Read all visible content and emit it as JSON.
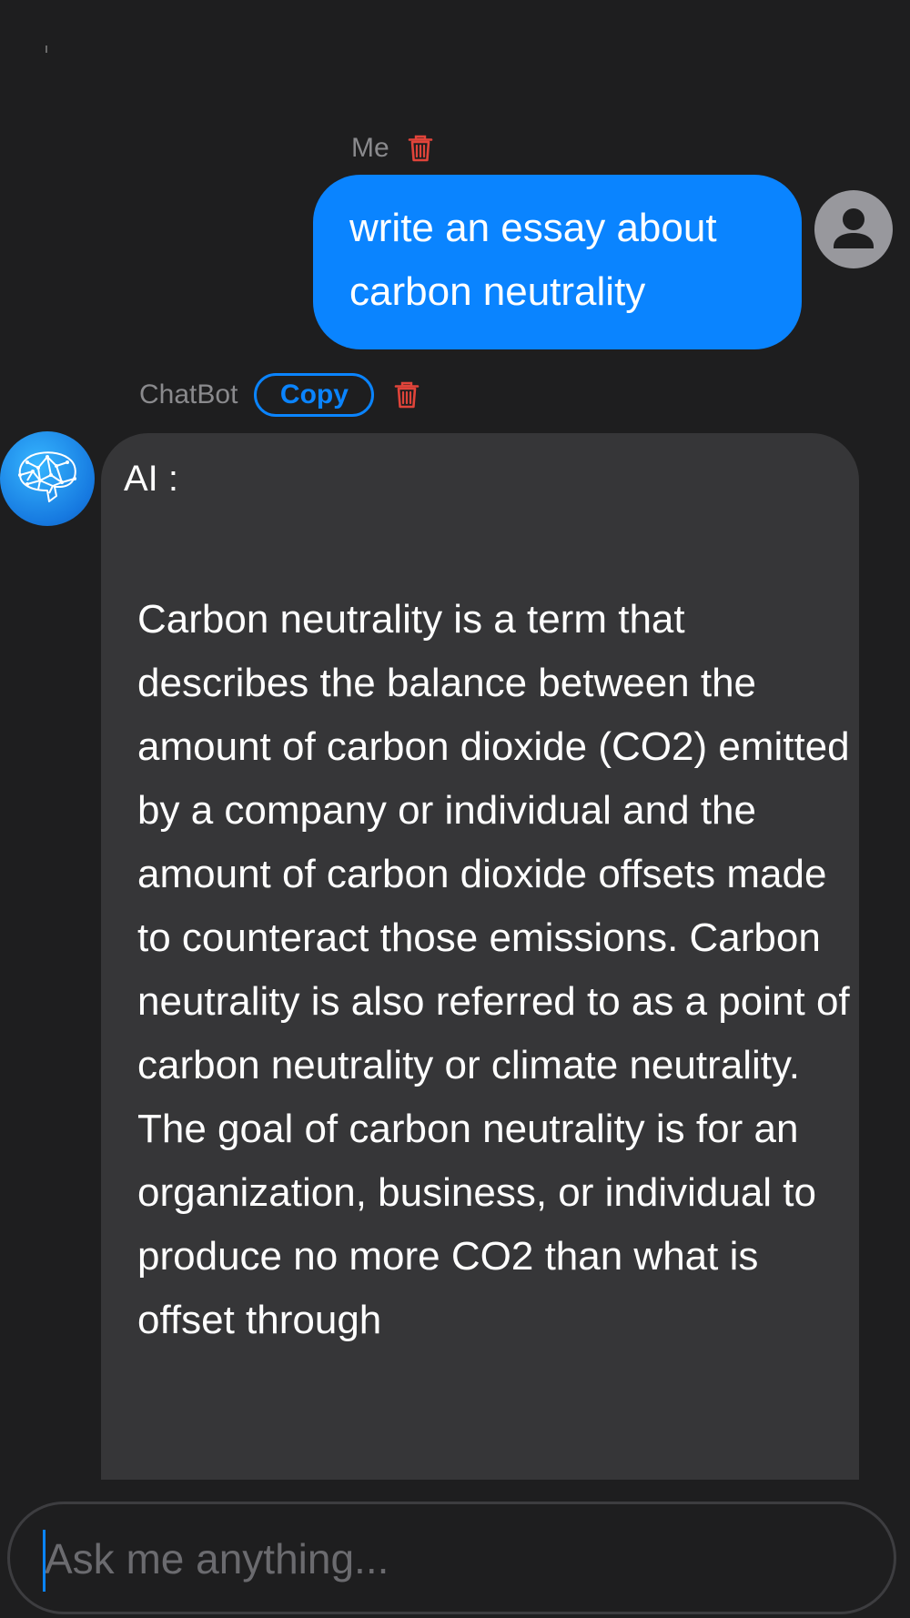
{
  "colors": {
    "background": "#1e1e1f",
    "user_bubble": "#0a84ff",
    "bot_bubble": "#363638",
    "accent": "#0a84ff",
    "delete": "#e0443a",
    "muted_text": "#8a8a8d"
  },
  "user_message": {
    "sender": "Me",
    "text": "write an essay about carbon neutrality",
    "delete_icon": "trash-icon",
    "avatar_icon": "person-icon"
  },
  "bot_message": {
    "sender": "ChatBot",
    "copy_label": "Copy",
    "delete_icon": "trash-icon",
    "avatar_icon": "brain-icon",
    "prefix": "AI :",
    "text": "Carbon neutrality is a term that describes the balance between the amount of carbon dioxide (CO2) emitted by a company or individual and the amount of carbon dioxide offsets made to counteract those emissions. Carbon neutrality is also referred to as a point of carbon neutrality or climate neutrality. The goal of carbon neutrality is for an organization, business, or individual to produce no more CO2 than what is offset through"
  },
  "composer": {
    "placeholder": "Ask me anything..."
  }
}
